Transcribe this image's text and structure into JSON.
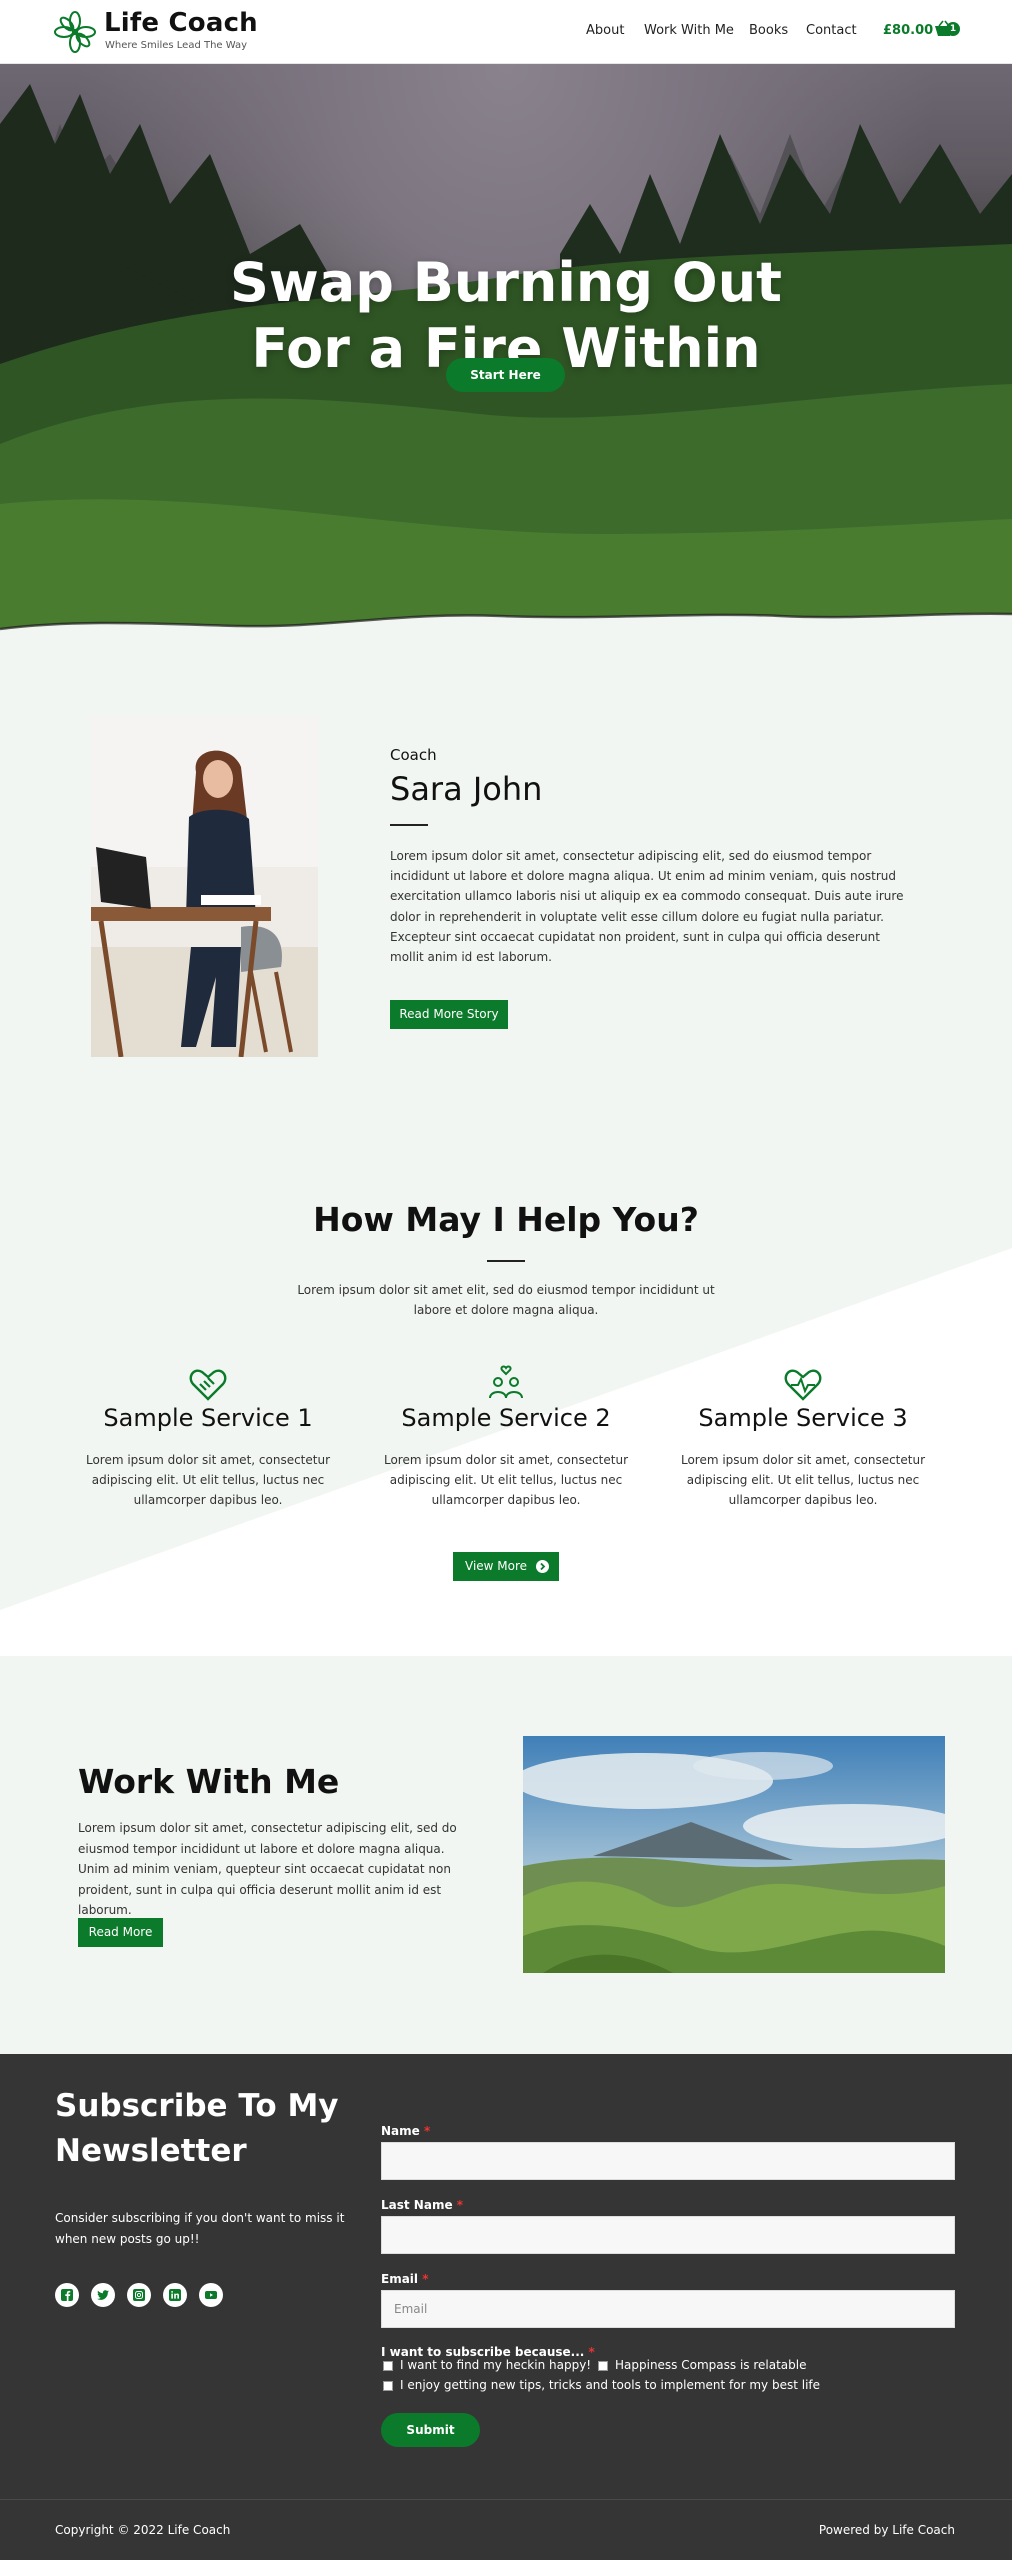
{
  "header": {
    "brand_title": "Life Coach",
    "brand_tagline": "Where Smiles Lead The Way",
    "nav": [
      "About",
      "Work With Me",
      "Books",
      "Contact"
    ],
    "cart_total": "£80.00",
    "cart_count": "1",
    "accent_color": "#0b7a2a"
  },
  "hero": {
    "title_line1": "Swap Burning Out",
    "title_line2": "For a Fire Within",
    "button": "Start Here"
  },
  "about": {
    "label": "Coach",
    "name": "Sara John",
    "text": "Lorem ipsum dolor sit amet, consectetur adipiscing elit, sed do eiusmod tempor incididunt ut labore et dolore magna aliqua. Ut enim ad minim veniam, quis nostrud exercitation ullamco laboris nisi ut aliquip ex ea commodo consequat. Duis aute irure dolor in reprehenderit in voluptate velit esse cillum dolore eu fugiat nulla pariatur. Excepteur sint occaecat cupidatat non proident, sunt in culpa qui officia deserunt mollit anim id est laborum.",
    "button": "Read More Story"
  },
  "services": {
    "title": "How May I Help You?",
    "intro": "Lorem ipsum dolor sit amet elit, sed do eiusmod tempor incididunt ut labore et dolore magna aliqua.",
    "items": [
      {
        "title": "Sample Service 1",
        "text": "Lorem ipsum dolor sit amet, consectetur adipiscing elit. Ut elit tellus, luctus nec ullamcorper dapibus leo.",
        "icon": "handshake-heart-icon"
      },
      {
        "title": "Sample Service 2",
        "text": "Lorem ipsum dolor sit amet, consectetur adipiscing elit. Ut elit tellus, luctus nec ullamcorper dapibus leo.",
        "icon": "people-heart-icon"
      },
      {
        "title": "Sample Service 3",
        "text": "Lorem ipsum dolor sit amet, consectetur adipiscing elit. Ut elit tellus, luctus nec ullamcorper dapibus leo.",
        "icon": "heartbeat-icon"
      }
    ],
    "button": "View More"
  },
  "work": {
    "title": "Work With Me",
    "text": "Lorem ipsum dolor sit amet, consectetur adipiscing elit, sed do eiusmod tempor incididunt ut labore et dolore magna aliqua. Unim ad minim veniam, quepteur sint occaecat cupidatat non proident, sunt in culpa qui officia deserunt mollit anim id est laborum.",
    "button": "Read More"
  },
  "newsletter": {
    "title": "Subscribe To My Newsletter",
    "description": "Consider subscribing if you don't want to miss it when new posts go up!!",
    "social": [
      "facebook-icon",
      "twitter-icon",
      "instagram-icon",
      "linkedin-icon",
      "youtube-icon"
    ],
    "form": {
      "name_label": "Name",
      "last_name_label": "Last Name",
      "email_label": "Email",
      "email_placeholder": "Email",
      "reason_label": "I want to subscribe because...",
      "required_mark": "*",
      "options": [
        "I want to find my heckin happy!",
        "Happiness Compass is relatable",
        "I enjoy getting new tips, tricks and tools to implement for my best life"
      ],
      "submit": "Submit"
    }
  },
  "footer": {
    "copyright": "Copyright © 2022 Life Coach",
    "powered": "Powered by Life Coach"
  }
}
